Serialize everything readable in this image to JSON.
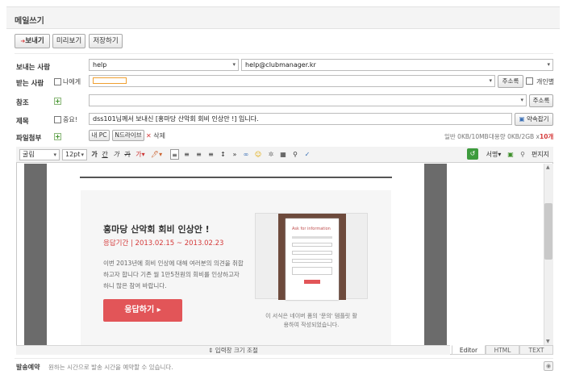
{
  "window": {
    "title": "메일쓰기"
  },
  "toolbar": {
    "send": "보내기",
    "preview": "미리보기",
    "save": "저장하기"
  },
  "form": {
    "sender_label": "보내는 사람",
    "sender_name": "help",
    "sender_email": "help@clubmanager.kr",
    "recipient_label": "받는 사람",
    "self_send": "나에게",
    "recipient_value": "",
    "address_book": "주소록",
    "individual": "개인별",
    "cc_label": "참조",
    "cc_value": "",
    "subject_label": "제목",
    "important": "중요!",
    "subject_value": "dss101님께서 보내신 [홍마당 산악회 회비 인상안 !] 입니다.",
    "signature_button": "약속잡기",
    "attach_label": "파일첨부",
    "my_pc": "내 PC",
    "n_drive": "N드라이브",
    "delete": "삭제",
    "attach_info_normal": "일반 0KB/10MB",
    "attach_info_large_prefix": "대용량 0KB/2GB x",
    "attach_info_large_count": "10개"
  },
  "editor_toolbar": {
    "font": "굴림",
    "size": "12pt",
    "signature": "서명",
    "letter": "편지지"
  },
  "content": {
    "heading": "홍마당 산악회 회비 인상안 !",
    "period": "응답기간 | 2013.02.15 ~ 2013.02.23",
    "body": "이번 2013년에 회비 인상에 대해 여러분의 의견을 취합하고자 합니다 기존 월 1만5천원의 회비를 인상하고자 하니 많은 참여 바랍니다.",
    "respond_button": "응답하기 ▸",
    "preview_title": "Ask for information",
    "footnote": "이 서식은 네이버 폼의 '문의' 템플릿 활용하여 작성되었습니다."
  },
  "editor_footer": {
    "resize": "⇕ 입력창 크기 조절",
    "tabs": [
      "Editor",
      "HTML",
      "TEXT"
    ]
  },
  "reserve": {
    "label": "발송예약",
    "text": "원하는 시간으로 발송 시간을 예약할 수 있습니다."
  },
  "colors": {
    "accent_red": "#d53b3b",
    "button_red": "#e25558",
    "brand_green": "#3d8f2a"
  }
}
